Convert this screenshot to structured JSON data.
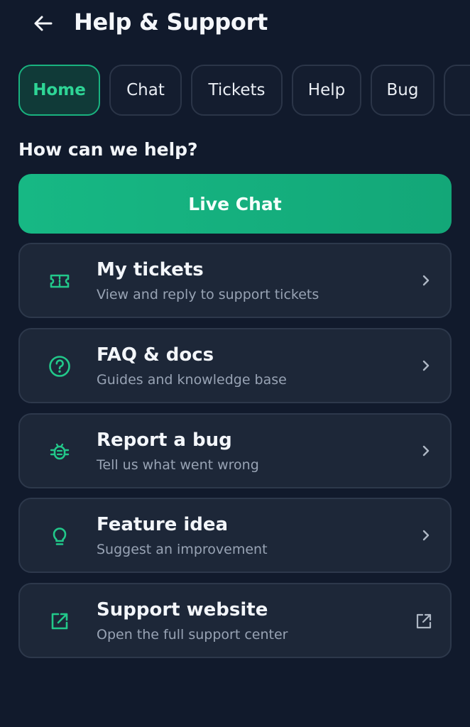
{
  "header": {
    "title": "Help & Support"
  },
  "tabs": [
    {
      "label": "Home",
      "active": true
    },
    {
      "label": "Chat",
      "active": false
    },
    {
      "label": "Tickets",
      "active": false
    },
    {
      "label": "Help",
      "active": false
    },
    {
      "label": "Bug",
      "active": false
    }
  ],
  "main": {
    "heading": "How can we help?",
    "live_chat_label": "Live Chat",
    "cards": [
      {
        "title": "My tickets",
        "subtitle": "View and reply to support tickets",
        "icon": "ticket-icon",
        "action_icon": "chevron-right-icon"
      },
      {
        "title": "FAQ & docs",
        "subtitle": "Guides and knowledge base",
        "icon": "help-circle-icon",
        "action_icon": "chevron-right-icon"
      },
      {
        "title": "Report a bug",
        "subtitle": "Tell us what went wrong",
        "icon": "bug-icon",
        "action_icon": "chevron-right-icon"
      },
      {
        "title": "Feature idea",
        "subtitle": "Suggest an improvement",
        "icon": "lightbulb-icon",
        "action_icon": "chevron-right-icon"
      },
      {
        "title": "Support website",
        "subtitle": "Open the full support center",
        "icon": "external-link-icon",
        "action_icon": "external-link-icon"
      }
    ]
  },
  "colors": {
    "background": "#111a2c",
    "card": "#1d2738",
    "accent": "#19b27f",
    "accent_text": "#2ed596"
  }
}
